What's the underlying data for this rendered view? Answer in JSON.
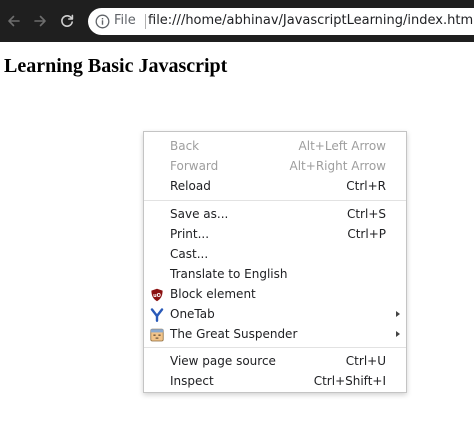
{
  "browser": {
    "scheme_label": "File",
    "url": "file:///home/abhinav/JavascriptLearning/index.html",
    "icons": {
      "back": "arrow-left-icon",
      "forward": "arrow-right-icon",
      "reload": "reload-icon",
      "info": "info-icon"
    }
  },
  "page": {
    "heading": "Learning Basic Javascript"
  },
  "context_menu": {
    "back": {
      "label": "Back",
      "shortcut": "Alt+Left Arrow"
    },
    "forward": {
      "label": "Forward",
      "shortcut": "Alt+Right Arrow"
    },
    "reload": {
      "label": "Reload",
      "shortcut": "Ctrl+R"
    },
    "save_as": {
      "label": "Save as...",
      "shortcut": "Ctrl+S"
    },
    "print": {
      "label": "Print...",
      "shortcut": "Ctrl+P"
    },
    "cast": {
      "label": "Cast..."
    },
    "translate": {
      "label": "Translate to English"
    },
    "block_element": {
      "label": "Block element",
      "icon": "ublock-origin-icon"
    },
    "onetab": {
      "label": "OneTab",
      "icon": "onetab-icon"
    },
    "great_suspender": {
      "label": "The Great Suspender",
      "icon": "great-suspender-icon"
    },
    "view_source": {
      "label": "View page source",
      "shortcut": "Ctrl+U"
    },
    "inspect": {
      "label": "Inspect",
      "shortcut": "Ctrl+Shift+I"
    }
  }
}
